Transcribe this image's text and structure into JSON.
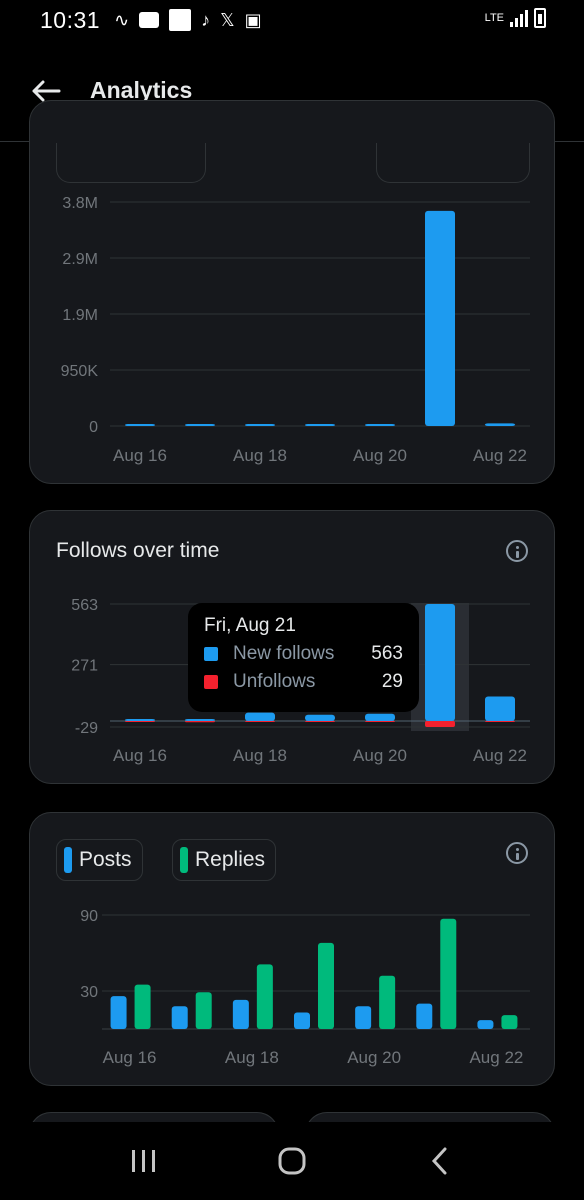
{
  "status_bar": {
    "time": "10:31",
    "network": "LTE"
  },
  "header": {
    "title": "Analytics"
  },
  "colors": {
    "blue": "#1d9bf0",
    "green": "#00ba7c",
    "red": "#f4212e",
    "card_bg": "#16181c",
    "border": "#2f3336"
  },
  "chart_data": [
    {
      "type": "bar",
      "categories": [
        "Aug 16",
        "Aug 17",
        "Aug 18",
        "Aug 19",
        "Aug 20",
        "Aug 21",
        "Aug 22"
      ],
      "values": [
        8000,
        5000,
        6000,
        5000,
        7000,
        3650000,
        45000
      ],
      "y_ticks": [
        "3.8M",
        "2.9M",
        "1.9M",
        "950K",
        "0"
      ],
      "x_tick_labels": [
        "Aug 16",
        "Aug 18",
        "Aug 20",
        "Aug 22"
      ],
      "ylim": [
        0,
        3800000
      ],
      "grid": true
    },
    {
      "type": "bar",
      "title": "Follows over time",
      "categories": [
        "Aug 16",
        "Aug 17",
        "Aug 18",
        "Aug 19",
        "Aug 20",
        "Aug 21",
        "Aug 22"
      ],
      "series": [
        {
          "name": "New follows",
          "values": [
            8,
            6,
            40,
            30,
            35,
            563,
            118
          ]
        },
        {
          "name": "Unfollows",
          "values": [
            3,
            6,
            4,
            3,
            3,
            29,
            2
          ]
        }
      ],
      "y_ticks": [
        "563",
        "271",
        "-29"
      ],
      "x_tick_labels": [
        "Aug 16",
        "Aug 18",
        "Aug 20",
        "Aug 22"
      ],
      "ylim": [
        -29,
        563
      ],
      "grid": true,
      "tooltip": {
        "date": "Fri, Aug 21",
        "rows": [
          {
            "name": "New follows",
            "value": "563"
          },
          {
            "name": "Unfollows",
            "value": "29"
          }
        ]
      }
    },
    {
      "type": "bar",
      "categories": [
        "Aug 16",
        "Aug 17",
        "Aug 18",
        "Aug 19",
        "Aug 20",
        "Aug 21",
        "Aug 22"
      ],
      "series": [
        {
          "name": "Posts",
          "values": [
            26,
            18,
            23,
            13,
            18,
            20,
            7
          ]
        },
        {
          "name": "Replies",
          "values": [
            35,
            29,
            51,
            68,
            42,
            87,
            11
          ]
        }
      ],
      "y_ticks": [
        "90",
        "30"
      ],
      "x_tick_labels": [
        "Aug 16",
        "Aug 18",
        "Aug 20",
        "Aug 22"
      ],
      "ylim": [
        0,
        100
      ],
      "grid": true,
      "legend": "top-left"
    }
  ]
}
